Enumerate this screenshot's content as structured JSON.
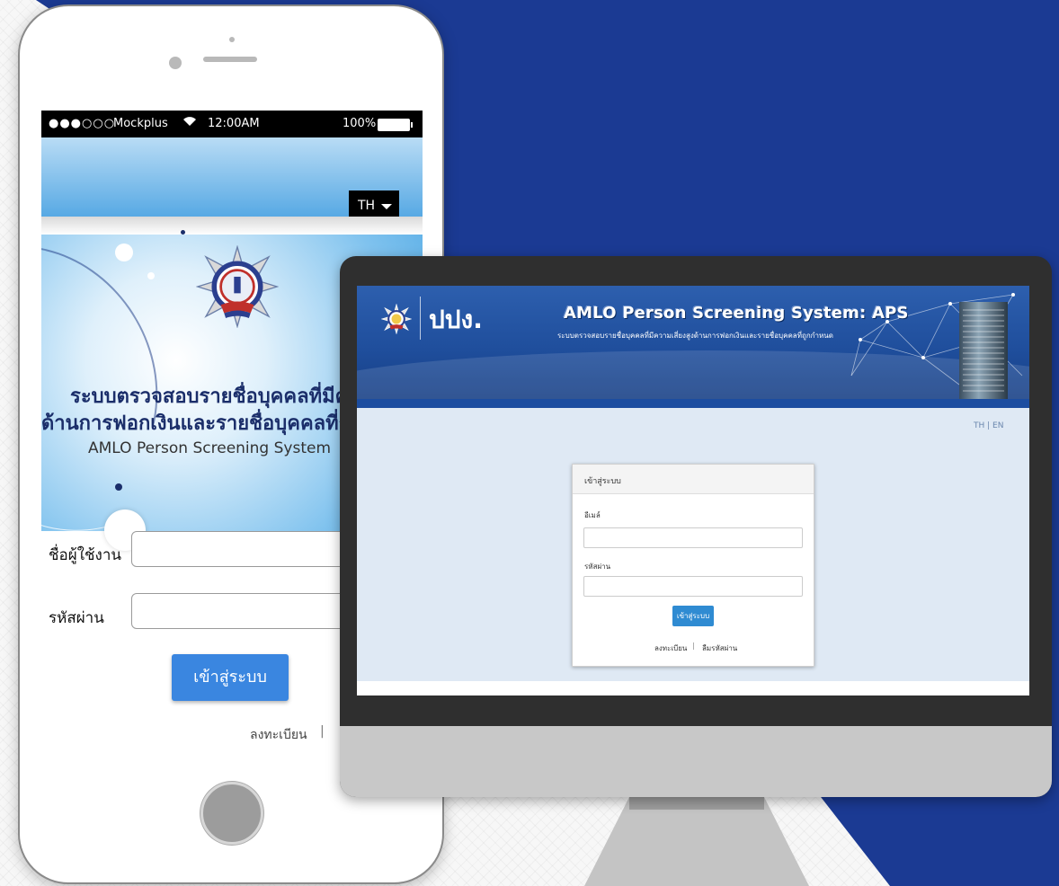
{
  "phone": {
    "status_bar": {
      "signal": "●●●○○○",
      "carrier": "Mockplus",
      "time": "12:00AM",
      "battery": "100%"
    },
    "language_select": {
      "value": "TH"
    },
    "title_line1": "ระบบตรวจสอบรายชื่อบุคคลที่มีความเ",
    "title_line2": "ด้านการฟอกเงินและรายชื่อบุคคลที่ถู",
    "title_line3": "AMLO Person Screening System",
    "username_label": "ชื่อผู้ใช้งาน",
    "password_label": "รหัสผ่าน",
    "login_button": "เข้าสู่ระบบ",
    "register_link": "ลงทะเบียน",
    "separator": "|"
  },
  "desktop": {
    "brand": "ปปง.",
    "title": "AMLO Person Screening System: APS",
    "subtitle": "ระบบตรวจสอบรายชื่อบุคคลที่มีความเสี่ยงสูงด้านการฟอกเงินและรายชื่อบุคคลที่ถูกกำหนด",
    "language_switch": "TH | EN",
    "login_card": {
      "heading": "เข้าสู่ระบบ",
      "email_label": "อีเมล์",
      "password_label": "รหัสผ่าน",
      "submit_button": "เข้าสู่ระบบ",
      "register_link": "ลงทะเบียน",
      "separator": "|",
      "forgot_link": "ลืมรหัสผ่าน"
    }
  },
  "colors": {
    "background_blue": "#1b3a93",
    "phone_button": "#3a86e0",
    "web_header": "#1f4e9c",
    "web_button": "#2f8bd2"
  }
}
